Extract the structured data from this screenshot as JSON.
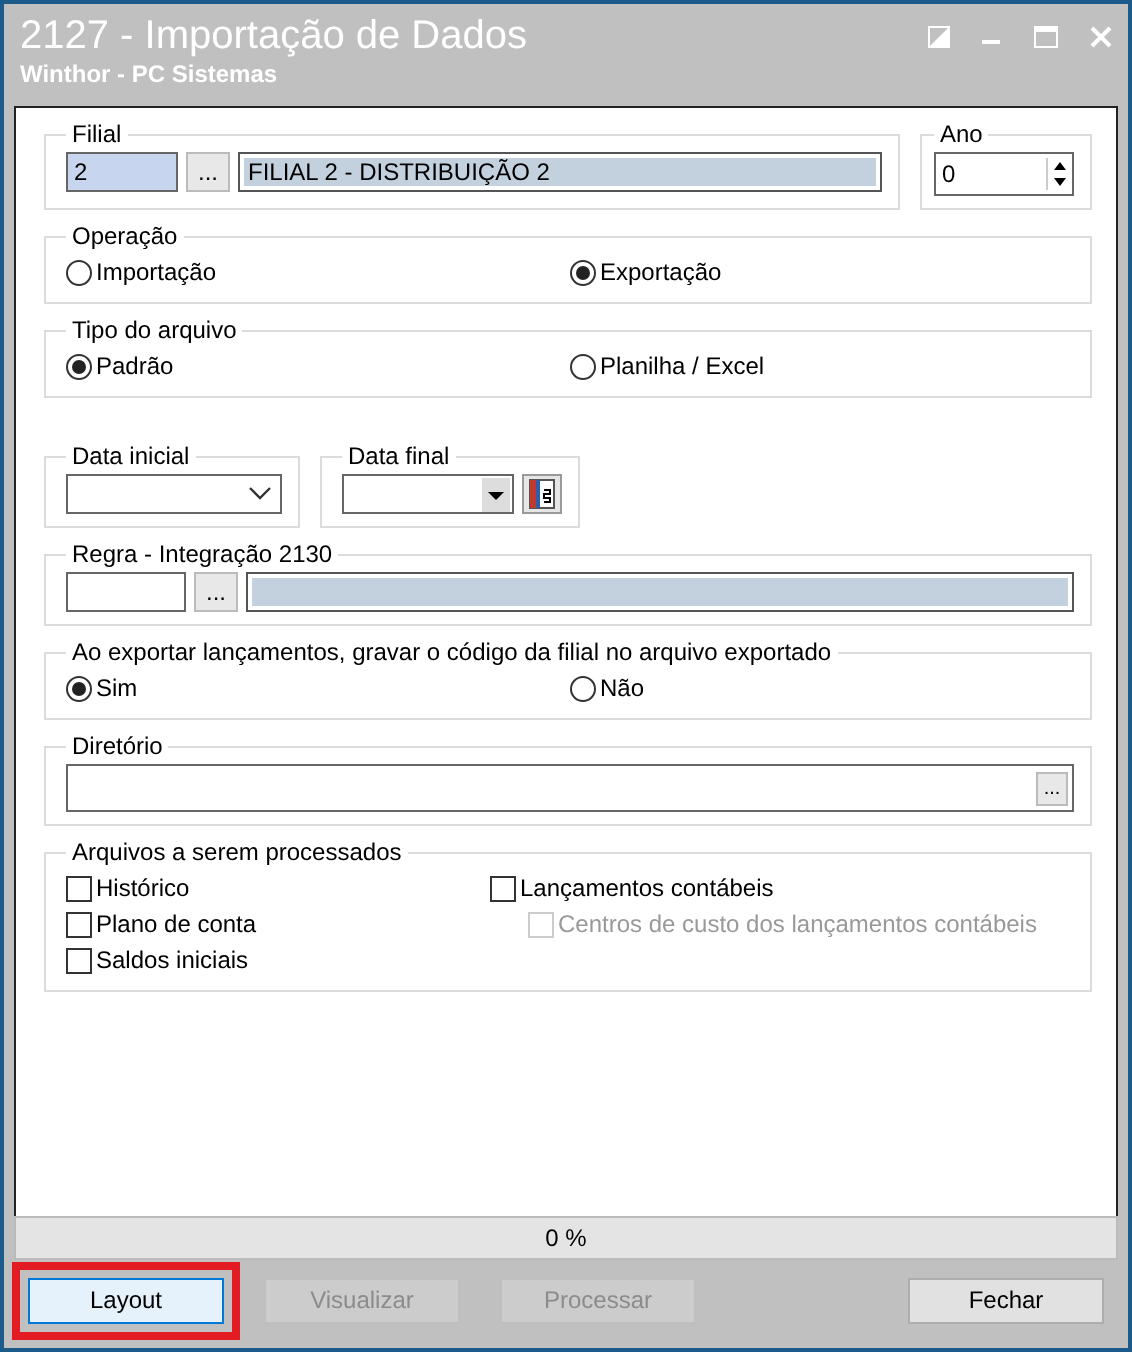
{
  "window": {
    "title": "2127 - Importação de Dados",
    "subtitle": "Winthor - PC Sistemas"
  },
  "filial": {
    "label": "Filial",
    "code": "2",
    "name": "FILIAL 2 - DISTRIBUIÇÃO 2",
    "browse": "..."
  },
  "ano": {
    "label": "Ano",
    "value": "0"
  },
  "operacao": {
    "label": "Operação",
    "options": [
      {
        "label": "Importação",
        "selected": false
      },
      {
        "label": "Exportação",
        "selected": true
      }
    ]
  },
  "tipo_arquivo": {
    "label": "Tipo do arquivo",
    "options": [
      {
        "label": "Padrão",
        "selected": true
      },
      {
        "label": "Planilha / Excel",
        "selected": false
      }
    ]
  },
  "data_inicial": {
    "label": "Data inicial"
  },
  "data_final": {
    "label": "Data final"
  },
  "regra": {
    "label": "Regra - Integração 2130",
    "browse": "..."
  },
  "codigo_filial": {
    "label": "Ao exportar lançamentos, gravar o código da filial no arquivo exportado",
    "options": [
      {
        "label": "Sim",
        "selected": true
      },
      {
        "label": "Não",
        "selected": false
      }
    ]
  },
  "diretorio": {
    "label": "Diretório",
    "browse": "..."
  },
  "arquivos": {
    "label": "Arquivos a serem processados",
    "columns": [
      [
        {
          "label": "Histórico",
          "checked": false,
          "disabled": false
        },
        {
          "label": "Plano de conta",
          "checked": false,
          "disabled": false
        },
        {
          "label": "Saldos iniciais",
          "checked": false,
          "disabled": false
        }
      ],
      [
        {
          "label": "Lançamentos contábeis",
          "checked": false,
          "disabled": false,
          "children": [
            {
              "label": "Centros de custo dos lançamentos contábeis",
              "checked": false,
              "disabled": true
            }
          ]
        }
      ]
    ]
  },
  "progress": {
    "level": 0,
    "reading": "0 %"
  },
  "buttons": [
    {
      "label": "Layout",
      "disabled": false,
      "highlighted": true
    },
    {
      "label": "Visualizar",
      "disabled": true,
      "highlighted": false
    },
    {
      "label": "Processar",
      "disabled": true,
      "highlighted": false
    },
    {
      "label": "Fechar",
      "disabled": false,
      "highlighted": false
    }
  ]
}
